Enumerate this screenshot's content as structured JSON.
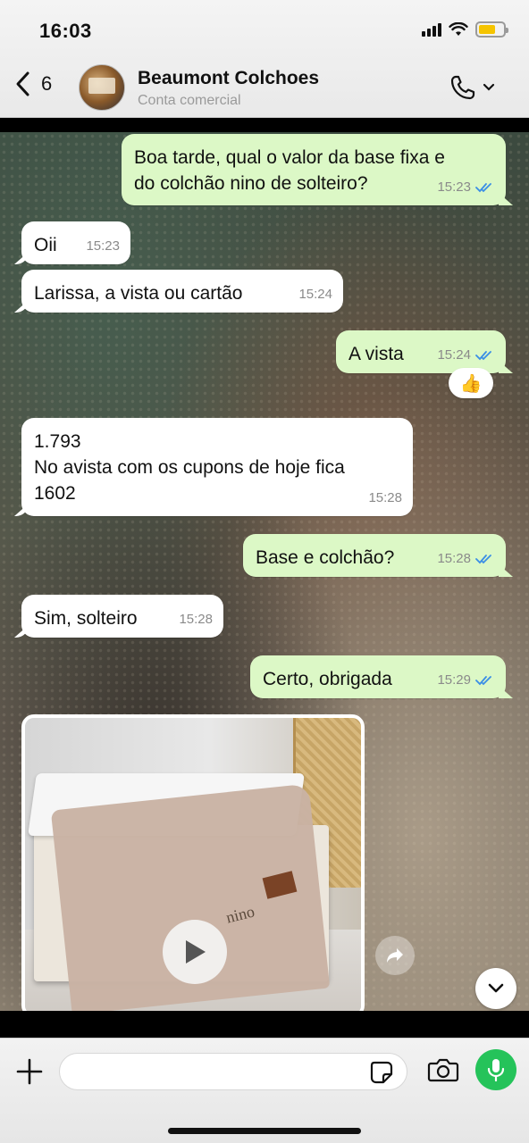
{
  "status_bar": {
    "time": "16:03",
    "battery_color": "#f5c400"
  },
  "header": {
    "back_count": "6",
    "contact_name": "Beaumont Colchoes",
    "contact_subtitle": "Conta comercial",
    "icons": {
      "back": "chevron-left-icon",
      "call": "phone-icon",
      "call_menu": "chevron-down-icon"
    }
  },
  "messages": [
    {
      "dir": "out",
      "text": "Boa tarde, qual o valor da base fixa e\ndo colchão nino de solteiro?",
      "time": "15:23",
      "read": true
    },
    {
      "dir": "in",
      "text": "Oii",
      "time": "15:23"
    },
    {
      "dir": "in",
      "text": "Larissa, a vista ou cartão",
      "time": "15:24"
    },
    {
      "dir": "out",
      "text": "A vista",
      "time": "15:24",
      "read": true,
      "reaction": "👍"
    },
    {
      "dir": "in",
      "text": "1.793\nNo avista com os cupons de hoje fica\n1602",
      "time": "15:28"
    },
    {
      "dir": "out",
      "text": "Base e colchão?",
      "time": "15:28",
      "read": true
    },
    {
      "dir": "in",
      "text": "Sim, solteiro",
      "time": "15:28"
    },
    {
      "dir": "out",
      "text": "Certo, obrigada",
      "time": "15:29",
      "read": true
    }
  ],
  "video": {
    "label": "nino",
    "icons": {
      "play": "play-icon",
      "forward": "forward-icon",
      "scroll": "chevron-down-icon"
    }
  },
  "input_bar": {
    "placeholder": "",
    "icons": {
      "attach": "plus-icon",
      "sticker": "sticker-icon",
      "camera": "camera-icon",
      "mic": "microphone-icon"
    },
    "mic_color": "#25c35a"
  },
  "colors": {
    "outgoing_bubble": "#dcf8c6",
    "incoming_bubble": "#ffffff",
    "read_ticks": "#3a8ee6"
  }
}
